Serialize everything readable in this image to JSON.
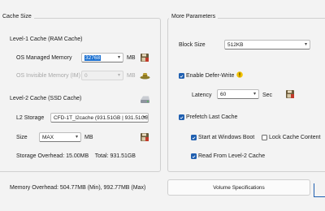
{
  "cache_size": {
    "group_title": "Cache Size",
    "level1": {
      "heading": "Level-1 Cache   (RAM Cache)",
      "os_managed_label": "OS Managed Memory",
      "os_managed_value": "32768",
      "os_managed_unit": "MB",
      "os_invisible_label": "OS Invisible Memory (IM)",
      "os_invisible_value": "0",
      "os_invisible_unit": "MB"
    },
    "level2": {
      "heading": "Level-2 Cache   (SSD Cache)",
      "storage_label": "L2 Storage",
      "storage_value": "CFD-1T_l2cache (931.51GB | 931.51GB",
      "size_label": "Size",
      "size_value": "MAX",
      "size_unit": "MB",
      "overhead_text": "Storage Overhead: 15.00MB    Total: 931.51GB"
    }
  },
  "more_parameters": {
    "group_title": "More Parameters",
    "block_size_label": "Block Size",
    "block_size_value": "512KB",
    "defer_write_label": "Enable Defer-Write",
    "defer_write_checked": true,
    "latency_label": "Latency",
    "latency_value": "60",
    "latency_unit": "Sec",
    "prefetch_label": "Prefetch Last Cache",
    "prefetch_checked": true,
    "start_windows_label": "Start at Windows Boot",
    "start_windows_checked": true,
    "lock_cache_label": "Lock Cache Content",
    "lock_cache_checked": false,
    "read_l2_label": "Read From Level-2 Cache",
    "read_l2_checked": true
  },
  "footer": {
    "memory_overhead": "Memory Overhead: 504.77MB (Min), 992.77MB (Max)",
    "volume_button": "Volume Specifications"
  },
  "colors": {
    "accent": "#1f5fb0",
    "warning": "#f2c200",
    "window_bg": "#f3f3f3"
  },
  "icons": [
    "save-settings-icon",
    "hat-icon",
    "disk-icon",
    "warning-icon",
    "dropdown-caret-icon"
  ]
}
